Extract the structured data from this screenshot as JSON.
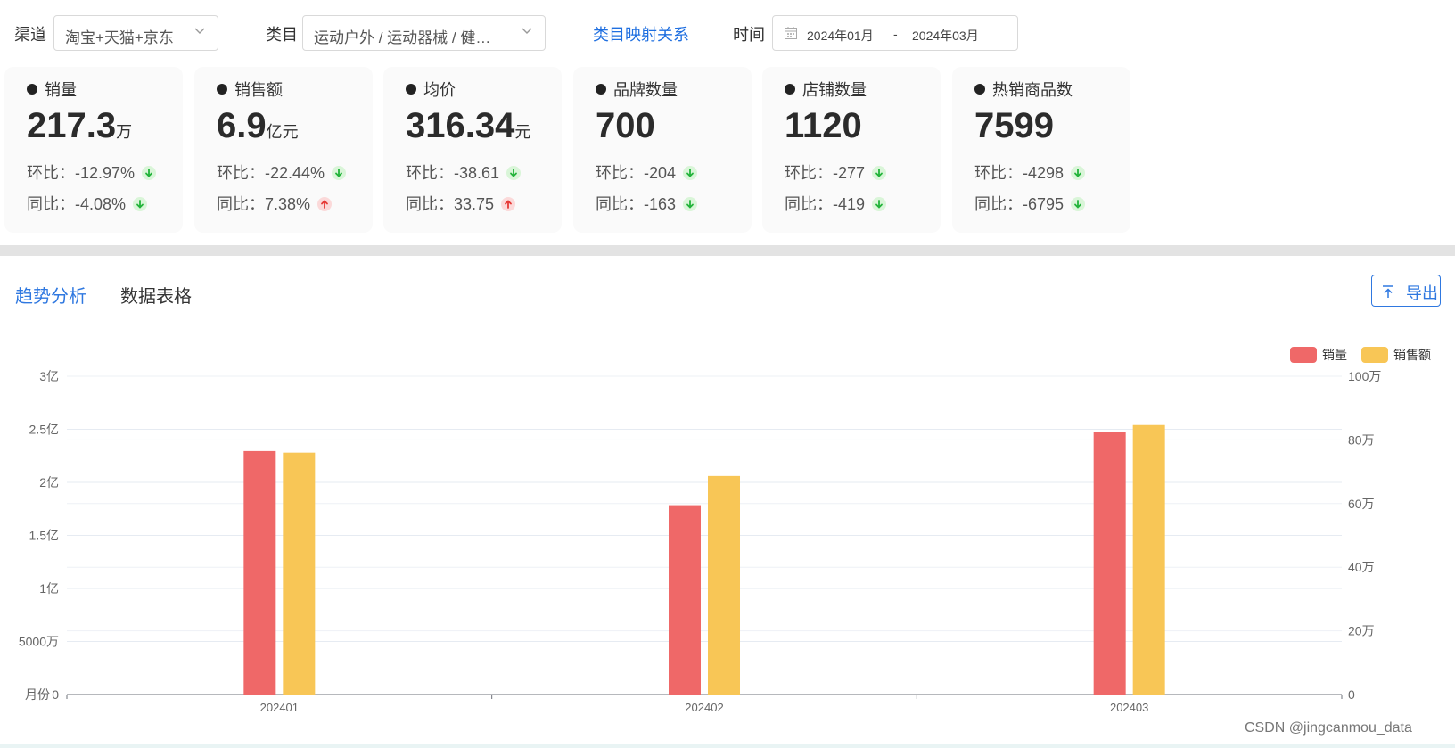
{
  "filters": {
    "channel_label": "渠道",
    "channel_value": "淘宝+天猫+京东",
    "category_label": "类目",
    "category_value": "运动户外 / 运动器械 / 健…",
    "mapping_link": "类目映射关系",
    "time_label": "时间",
    "date_start": "2024年01月",
    "date_sep": "-",
    "date_end": "2024年03月"
  },
  "cards": [
    {
      "title": "销量",
      "value": "217.3",
      "unit": "万",
      "mom_label": "环比：",
      "mom": "-12.97%",
      "mom_dir": "down",
      "yoy_label": "同比：",
      "yoy": "-4.08%",
      "yoy_dir": "down"
    },
    {
      "title": "销售额",
      "value": "6.9",
      "unit": "亿元",
      "mom_label": "环比：",
      "mom": "-22.44%",
      "mom_dir": "down",
      "yoy_label": "同比：",
      "yoy": "7.38%",
      "yoy_dir": "up"
    },
    {
      "title": "均价",
      "value": "316.34",
      "unit": "元",
      "mom_label": "环比：",
      "mom": "-38.61",
      "mom_dir": "down",
      "yoy_label": "同比：",
      "yoy": "33.75",
      "yoy_dir": "up"
    },
    {
      "title": "品牌数量",
      "value": "700",
      "unit": "",
      "mom_label": "环比：",
      "mom": "-204",
      "mom_dir": "down",
      "yoy_label": "同比：",
      "yoy": "-163",
      "yoy_dir": "down"
    },
    {
      "title": "店铺数量",
      "value": "1120",
      "unit": "",
      "mom_label": "环比：",
      "mom": "-277",
      "mom_dir": "down",
      "yoy_label": "同比：",
      "yoy": "-419",
      "yoy_dir": "down"
    },
    {
      "title": "热销商品数",
      "value": "7599",
      "unit": "",
      "mom_label": "环比：",
      "mom": "-4298",
      "mom_dir": "down",
      "yoy_label": "同比：",
      "yoy": "-6795",
      "yoy_dir": "down"
    }
  ],
  "tabs": [
    {
      "label": "趋势分析",
      "active": true
    },
    {
      "label": "数据表格",
      "active": false
    }
  ],
  "export_label": "导出",
  "colors": {
    "sales_volume": "#ef6868",
    "sales_amount": "#f8c656",
    "accent": "#2f78e0",
    "up": "#e53935",
    "down": "#22b33a"
  },
  "chart_data": {
    "type": "bar",
    "categories": [
      "202401",
      "202402",
      "202403"
    ],
    "series": [
      {
        "name": "销量",
        "values": [
          76.5,
          59.5,
          82.5
        ],
        "axis": "right"
      },
      {
        "name": "销售额",
        "values": [
          228000000,
          206000000,
          254000000
        ],
        "axis": "left"
      }
    ],
    "left_axis": {
      "ticks": [
        "0",
        "5000万",
        "1亿",
        "1.5亿",
        "2亿",
        "2.5亿",
        "3亿"
      ],
      "max": 300000000,
      "label": "月份"
    },
    "right_axis": {
      "ticks": [
        "0",
        "20万",
        "40万",
        "60万",
        "80万",
        "100万"
      ],
      "max": 100
    },
    "grid": true,
    "legend": "top-right"
  },
  "watermark": "CSDN @jingcanmou_data"
}
